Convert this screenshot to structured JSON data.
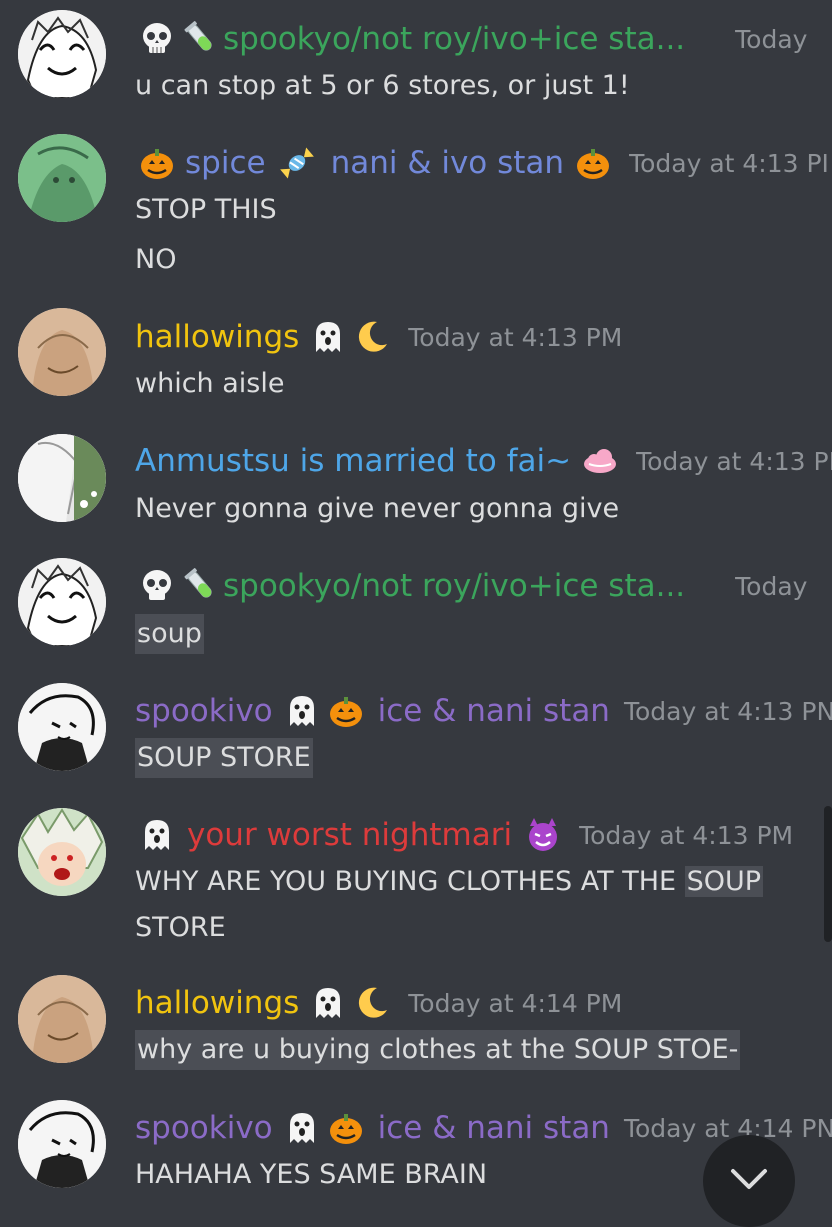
{
  "colors": {
    "background": "#36393f",
    "timestamp": "#8e9297",
    "text": "#dcddde",
    "green": "#3ba55c",
    "blue": "#7289da",
    "yellow": "#f1c40f",
    "lightblue": "#4ea6e8",
    "purple": "#8b6bc7",
    "red": "#dd3b3b"
  },
  "messages": [
    {
      "author": "spookyo/not roy/ivo+ice sta...",
      "name_color": "green",
      "prefix_icons": [
        "skull-icon",
        "test-tube-icon"
      ],
      "suffix_icons": [],
      "timestamp": "Today",
      "lines": [
        {
          "text": "u can stop at 5 or 6 stores, or just 1!",
          "highlight": false
        }
      ]
    },
    {
      "author": "spice",
      "author_extra": "nani & ivo stan",
      "name_color": "blue",
      "prefix_icons": [
        "pumpkin-icon"
      ],
      "mid_icons": [
        "candy-icon"
      ],
      "suffix_icons": [
        "pumpkin-icon"
      ],
      "timestamp": "Today at 4:13 PI",
      "lines": [
        {
          "text": "STOP THIS",
          "highlight": false
        },
        {
          "text": "NO",
          "highlight": false
        }
      ]
    },
    {
      "author": "hallowings",
      "name_color": "yellow",
      "prefix_icons": [],
      "suffix_icons": [
        "ghost-icon",
        "moon-icon"
      ],
      "timestamp": "Today at 4:13 PM",
      "lines": [
        {
          "text": "which aisle",
          "highlight": false
        }
      ]
    },
    {
      "author": "Anmustsu is married to fai~",
      "name_color": "lightblue",
      "prefix_icons": [],
      "suffix_icons": [
        "cloud-icon"
      ],
      "timestamp": "Today at 4:13 PI",
      "lines": [
        {
          "text": "Never gonna give never gonna give",
          "highlight": false
        }
      ]
    },
    {
      "author": "spookyo/not roy/ivo+ice sta...",
      "name_color": "green",
      "prefix_icons": [
        "skull-icon",
        "test-tube-icon"
      ],
      "suffix_icons": [],
      "timestamp": "Today",
      "lines": [
        {
          "text": "soup",
          "highlight": true
        }
      ]
    },
    {
      "author": "spookivo",
      "author_extra": "ice & nani stan",
      "name_color": "purple",
      "prefix_icons": [],
      "mid_icons": [
        "ghost-icon",
        "pumpkin-icon"
      ],
      "suffix_icons": [],
      "timestamp": "Today at 4:13 PN",
      "lines": [
        {
          "text": "SOUP STORE",
          "highlight": true
        }
      ]
    },
    {
      "author": "your worst nightmari",
      "name_color": "red",
      "prefix_icons": [
        "ghost-icon"
      ],
      "suffix_icons": [
        "devil-icon"
      ],
      "timestamp": "Today at 4:13 PM",
      "lines": [
        {
          "text": "WHY ARE YOU BUYING CLOTHES AT THE ",
          "highlight": false,
          "tail": "SOUP"
        },
        {
          "text": "STORE",
          "highlight": false
        }
      ]
    },
    {
      "author": "hallowings",
      "name_color": "yellow",
      "prefix_icons": [],
      "suffix_icons": [
        "ghost-icon",
        "moon-icon"
      ],
      "timestamp": "Today at 4:14 PM",
      "lines": [
        {
          "text": "why are u buying clothes at the SOUP STOE-",
          "highlight": true
        }
      ]
    },
    {
      "author": "spookivo",
      "author_extra": "ice & nani stan",
      "name_color": "purple",
      "prefix_icons": [],
      "mid_icons": [
        "ghost-icon",
        "pumpkin-icon"
      ],
      "suffix_icons": [],
      "timestamp": "Today at 4:14 PN",
      "lines": [
        {
          "text": "HAHAHA YES SAME BRAIN",
          "highlight": false
        }
      ]
    }
  ],
  "jump_button": {
    "icon": "chevron-down-icon"
  }
}
